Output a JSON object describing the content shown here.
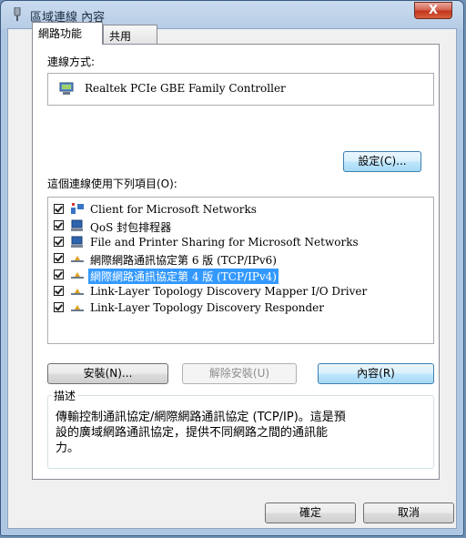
{
  "window": {
    "title": "區域連線 內容",
    "close_label": "X"
  },
  "tabs": [
    {
      "label": "網路功能"
    },
    {
      "label": "共用"
    }
  ],
  "connect_using": {
    "label": "連線方式:",
    "adapter_name": "Realtek PCIe GBE Family Controller",
    "configure_label": "設定(C)..."
  },
  "items_list": {
    "label": "這個連線使用下列項目(O):",
    "items": [
      {
        "label": "Client for Microsoft Networks",
        "checked": true,
        "icon": "network-client-icon"
      },
      {
        "label": "QoS 封包排程器",
        "checked": true,
        "icon": "service-icon"
      },
      {
        "label": "File and Printer Sharing for Microsoft Networks",
        "checked": true,
        "icon": "service-icon"
      },
      {
        "label": "網際網路通訊協定第 6 版 (TCP/IPv6)",
        "checked": true,
        "icon": "protocol-icon"
      },
      {
        "label": "網際網路通訊協定第 4 版 (TCP/IPv4)",
        "checked": true,
        "icon": "protocol-icon",
        "selected": true
      },
      {
        "label": "Link-Layer Topology Discovery Mapper I/O Driver",
        "checked": true,
        "icon": "protocol-icon"
      },
      {
        "label": "Link-Layer Topology Discovery Responder",
        "checked": true,
        "icon": "protocol-icon"
      }
    ]
  },
  "actions": {
    "install": "安裝(N)...",
    "uninstall": "解除安裝(U)",
    "properties": "內容(R)"
  },
  "description": {
    "title": "描述",
    "line1": "傳輸控制通訊協定/網際網路通訊協定 (TCP/IP)。這是預",
    "line2": "設的廣域網路通訊協定，提供不同網路之間的通訊能",
    "line3": "力。"
  },
  "footer": {
    "ok": "確定",
    "cancel": "取消"
  },
  "colors": {
    "selection": "#3399ff",
    "close_button": "#c1331d"
  }
}
